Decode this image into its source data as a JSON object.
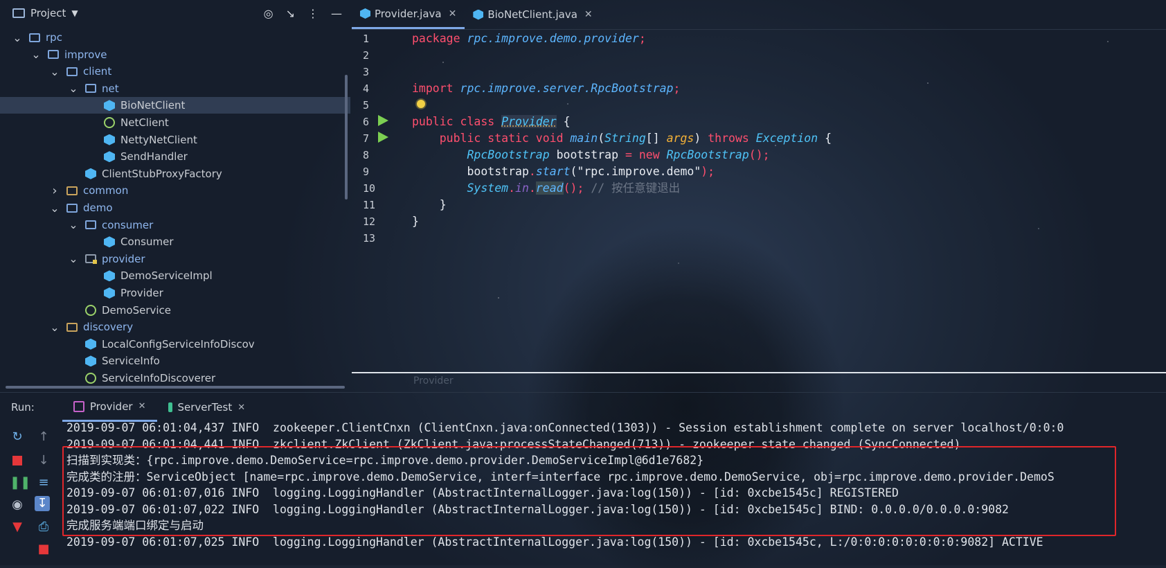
{
  "project_panel": {
    "title": "Project",
    "tree": [
      {
        "label": "rpc",
        "kind": "package",
        "level": 4,
        "expanded": true
      },
      {
        "label": "improve",
        "kind": "package",
        "level": 5,
        "expanded": true
      },
      {
        "label": "client",
        "kind": "package",
        "level": 6,
        "expanded": true
      },
      {
        "label": "net",
        "kind": "package",
        "level": 7,
        "expanded": true
      },
      {
        "label": "BioNetClient",
        "kind": "class",
        "level": 8,
        "selected": true
      },
      {
        "label": "NetClient",
        "kind": "interface",
        "level": 8
      },
      {
        "label": "NettyNetClient",
        "kind": "class",
        "level": 8
      },
      {
        "label": "SendHandler",
        "kind": "class",
        "level": 8
      },
      {
        "label": "ClientStubProxyFactory",
        "kind": "class",
        "level": 7
      },
      {
        "label": "common",
        "kind": "folder",
        "level": 6,
        "expanded": false
      },
      {
        "label": "demo",
        "kind": "package",
        "level": 6,
        "expanded": true
      },
      {
        "label": "consumer",
        "kind": "package",
        "level": 7,
        "expanded": true
      },
      {
        "label": "Consumer",
        "kind": "class",
        "level": 8
      },
      {
        "label": "provider",
        "kind": "package-special",
        "level": 7,
        "expanded": true
      },
      {
        "label": "DemoServiceImpl",
        "kind": "class",
        "level": 8
      },
      {
        "label": "Provider",
        "kind": "class",
        "level": 8
      },
      {
        "label": "DemoService",
        "kind": "interface",
        "level": 7
      },
      {
        "label": "discovery",
        "kind": "folder",
        "level": 6,
        "expanded": true
      },
      {
        "label": "LocalConfigServiceInfoDiscov",
        "kind": "class",
        "level": 7
      },
      {
        "label": "ServiceInfo",
        "kind": "class",
        "level": 7
      },
      {
        "label": "ServiceInfoDiscoverer",
        "kind": "interface",
        "level": 7
      }
    ]
  },
  "editor": {
    "tabs": [
      {
        "label": "Provider.java",
        "active": true
      },
      {
        "label": "BioNetClient.java",
        "active": false
      }
    ],
    "line_numbers": [
      "1",
      "2",
      "3",
      "4",
      "5",
      "6",
      "7",
      "8",
      "9",
      "10",
      "11",
      "12",
      "13"
    ],
    "code": {
      "l1_kw": "package",
      "l1_pkg": "rpc.improve.demo.provider",
      "l1_end": ";",
      "l4_kw": "import",
      "l4_pkg": "rpc.improve.server.RpcBootstrap",
      "l4_end": ";",
      "l6_kw": "public class",
      "l6_name": "Provider",
      "l6_end": " {",
      "l7_kw1": "    public static void",
      "l7_fn": "main",
      "l7_p1": "(",
      "l7_ty": "String",
      "l7_p2": "[] ",
      "l7_pm": "args",
      "l7_p3": ") ",
      "l7_kw2": "throws",
      "l7_ty2": "Exception",
      "l7_end": " {",
      "l8_ty": "        RpcBootstrap",
      "l8_var": " bootstrap ",
      "l8_eq": "=",
      "l8_kw": " new",
      "l8_ty2": " RpcBootstrap",
      "l8_end": "();",
      "l9_var": "        bootstrap",
      "l9_dot": ".",
      "l9_fn": "start",
      "l9_p1": "(",
      "l9_str": "\"rpc.improve.demo\"",
      "l9_end": ");",
      "l10_ty": "        System",
      "l10_dot": ".",
      "l10_in": "in",
      "l10_dot2": ".",
      "l10_fn": "read",
      "l10_end": "();",
      "l10_cm": " // 按任意键退出",
      "l11": "    }",
      "l12": "}"
    },
    "breadcrumb": "Provider"
  },
  "run_panel": {
    "label": "Run:",
    "tabs": [
      {
        "label": "Provider",
        "active": true
      },
      {
        "label": "ServerTest",
        "active": false
      }
    ],
    "console_lines": [
      "2019-09-07 06:01:04,437 INFO  zookeeper.ClientCnxn (ClientCnxn.java:onConnected(1303)) - Session establishment complete on server localhost/0:0:0",
      "2019-09-07 06:01:04,441 INFO  zkclient.ZkClient (ZkClient.java:processStateChanged(713)) - zookeeper state changed (SyncConnected)",
      "扫描到实现类：{rpc.improve.demo.DemoService=rpc.improve.demo.provider.DemoServiceImpl@6d1e7682}",
      "完成类的注册：ServiceObject [name=rpc.improve.demo.DemoService, interf=interface rpc.improve.demo.DemoService, obj=rpc.improve.demo.provider.DemoS",
      "2019-09-07 06:01:07,016 INFO  logging.LoggingHandler (AbstractInternalLogger.java:log(150)) - [id: 0xcbe1545c] REGISTERED",
      "2019-09-07 06:01:07,022 INFO  logging.LoggingHandler (AbstractInternalLogger.java:log(150)) - [id: 0xcbe1545c] BIND: 0.0.0.0/0.0.0.0:9082",
      "完成服务端端口绑定与启动",
      "2019-09-07 06:01:07,025 INFO  logging.LoggingHandler (AbstractInternalLogger.java:log(150)) - [id: 0xcbe1545c, L:/0:0:0:0:0:0:0:0:9082] ACTIVE"
    ]
  },
  "colors": {
    "keyword": "#ff4f6e",
    "type": "#4fc3f7",
    "param": "#f5b237",
    "highlight_box": "#e0262a"
  }
}
